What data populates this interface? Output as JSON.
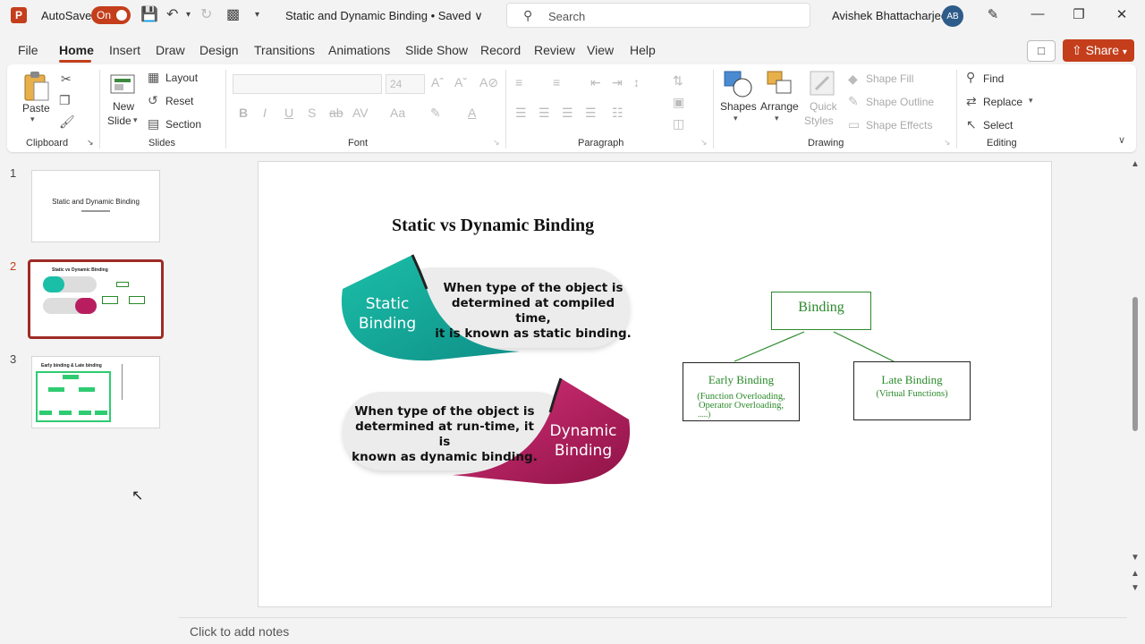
{
  "titlebar": {
    "app_logo": "P",
    "autosave_label": "AutoSave",
    "autosave_state": "On",
    "doc_title": "Static and Dynamic Binding • Saved ∨",
    "search_placeholder": "Search",
    "user_name": "Avishek Bhattacharjee",
    "user_initials": "AB"
  },
  "tabs": [
    "File",
    "Home",
    "Insert",
    "Draw",
    "Design",
    "Transitions",
    "Animations",
    "Slide Show",
    "Record",
    "Review",
    "View",
    "Help"
  ],
  "share_label": "Share",
  "ribbon": {
    "clipboard": {
      "label": "Clipboard",
      "paste": "Paste"
    },
    "slides": {
      "label": "Slides",
      "new_slide_1": "New",
      "new_slide_2": "Slide",
      "layout": "Layout",
      "reset": "Reset",
      "section": "Section"
    },
    "font": {
      "label": "Font",
      "size": "24"
    },
    "paragraph": {
      "label": "Paragraph"
    },
    "drawing": {
      "label": "Drawing",
      "shapes": "Shapes",
      "arrange": "Arrange",
      "quick_styles_1": "Quick",
      "quick_styles_2": "Styles",
      "shape_fill": "Shape Fill",
      "shape_outline": "Shape Outline",
      "shape_effects": "Shape Effects"
    },
    "editing": {
      "label": "Editing",
      "find": "Find",
      "replace": "Replace",
      "select": "Select"
    }
  },
  "thumbnails": [
    {
      "number": "1",
      "title": "Static and Dynamic Binding"
    },
    {
      "number": "2",
      "title": "Static vs Dynamic Binding"
    },
    {
      "number": "3",
      "title": "Early binding & Late binding"
    }
  ],
  "slide": {
    "title": "Static vs Dynamic Binding",
    "static_label_1": "Static",
    "static_label_2": "Binding",
    "static_desc_1": "When type of the object is",
    "static_desc_2": "determined at compiled time,",
    "static_desc_3": "it is known as static binding.",
    "dynamic_label_1": "Dynamic",
    "dynamic_label_2": "Binding",
    "dynamic_desc_1": "When type of the object is",
    "dynamic_desc_2": "determined at run-time, it is",
    "dynamic_desc_3": "known as dynamic binding.",
    "binding_box": "Binding",
    "early_title": "Early  Binding",
    "early_sub_1": "(Function  Overloading,",
    "early_sub_2": "Operator  Overloading,",
    "early_sub_3": ".....)",
    "late_title": "Late  Binding",
    "late_sub": "(Virtual  Functions)"
  },
  "notes_placeholder": "Click to add notes",
  "colors": {
    "accent": "#c43e1c",
    "teal": "#1bbfa8",
    "magenta": "#b81e5f",
    "green": "#2a8a2a"
  }
}
